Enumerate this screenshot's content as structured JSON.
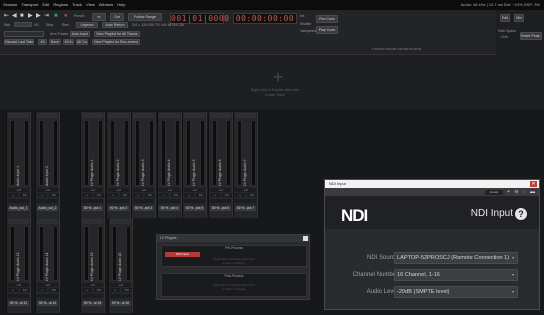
{
  "menubar": {
    "items": [
      "Session",
      "Transport",
      "Edit",
      "Regions",
      "Track",
      "View",
      "Window",
      "Help"
    ],
    "status": "Audio: 48 kHz | 10.7 ms  Buf: ~24%  DSP: 3%"
  },
  "toolbar": {
    "punch": "Punch:",
    "in_label": "In",
    "out_label": "Out",
    "follow_range": "Follow Range",
    "clock_bbt": "001|01|0000",
    "clock_time": "00:00:00:00",
    "int_label": "Int.",
    "rec_cues": "Rec Cues",
    "play_cues": "Play Cues",
    "shuttle_label": "Shuttle",
    "vari_label": "Varispeed",
    "rec_label": "Rec:",
    "layered": "Layered",
    "auto_return": "Auto Return",
    "meter_line": "1/4  =  120.000    TS:  4/4     INT/M-Clk",
    "stop_label": "Stop",
    "vs": "VS",
    "zero_label": "0db",
    "arm_tracks": "Arm Tracks",
    "auto_input": "Auto Input",
    "new_playlist_all": "New Playlist for All Tracks",
    "discard_take": "Discard Last Take",
    "all": "All",
    "none": "None",
    "all_in": "All In",
    "all_out": "All Out",
    "new_playlist_rec": "New Playlist for Rec-armed",
    "ruler": "1:00:000    2:00:000    3:00:000    00:00:00",
    "disk_space": "Disk Space",
    "disk_value": ">24h",
    "reset_peak": "Reset Peak Hold",
    "editor": "Edit",
    "mixer": "Mix"
  },
  "tracks_area": {
    "hint_line1": "Right-click or Double-click here",
    "hint_line2": "to add Track"
  },
  "strips_top": [
    {
      "name": "Audio Input 1",
      "bottom": "Audio_out_1"
    },
    {
      "name": "Audio Input 2",
      "bottom": "Audio_out_2"
    },
    {
      "name": "LV Plugin Audio 1",
      "bottom": "50 %...put 1"
    },
    {
      "name": "LV Plugin Audio 2",
      "bottom": "50 %...put 2"
    },
    {
      "name": "LV Plugin Audio 3",
      "bottom": "50 %...put 3"
    },
    {
      "name": "LV Plugin Audio 4",
      "bottom": "50 %...put 4"
    },
    {
      "name": "LV Plugin Audio 5",
      "bottom": "50 %...put 5"
    },
    {
      "name": "LV Plugin Audio 6",
      "bottom": "50 %...put 6"
    },
    {
      "name": "LV Plugin Audio 7",
      "bottom": "50 %...put 7"
    }
  ],
  "strips_bottom": [
    {
      "name": "LV Plugin Audio 12",
      "bottom": "50 %...ut 12"
    },
    {
      "name": "LV Plugin Audio 14",
      "bottom": "50 %...ut 14"
    },
    {
      "name": "LV Plugin Audio 15",
      "bottom": "50 %...ut 15"
    },
    {
      "name": "LV Plugin Audio 16",
      "bottom": "50 %...ut 16"
    }
  ],
  "strip_common": {
    "meter": "-inf",
    "plus": "+",
    "fx": "FX"
  },
  "plugin_panel": {
    "title": "LV Plugins",
    "prefader": "Pre-Process",
    "postfader": "Post-Process",
    "plugin_name": "NDI Input",
    "hint1": "Right click or Double-click here",
    "hint2": "to add LV Plugins"
  },
  "ndi_window": {
    "title": "NDI Input",
    "preset": "(none)",
    "logo": "NDI",
    "heading": "NDI Input",
    "help": "?",
    "fields": [
      {
        "label": "NDI Source",
        "value": "LAPTOP-52PROSCJ (Remote Connection 1)"
      },
      {
        "label": "Channel Number",
        "value": "16 Channel, 1-16"
      },
      {
        "label": "Audio Level",
        "value": "-20dB (SMPTE level)"
      }
    ]
  },
  "colors": {
    "accent_red": "#c45a50",
    "ndi_close": "#c83a32",
    "plugin_red": "#b43b36"
  }
}
